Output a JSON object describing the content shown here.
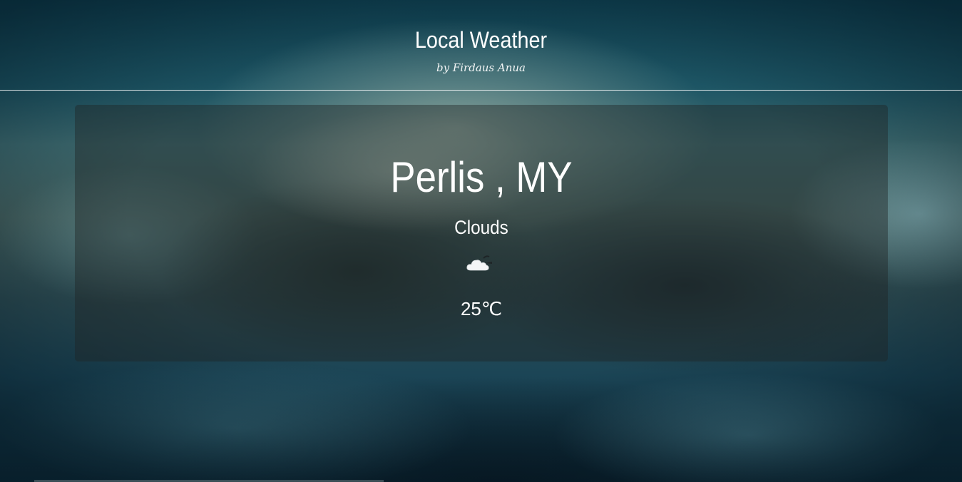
{
  "header": {
    "title": "Local Weather",
    "byline": "by Firdaus Anua"
  },
  "weather": {
    "location": "Perlis , MY",
    "condition": "Clouds",
    "icon": "cloud-icon",
    "temperature": "25℃"
  },
  "colors": {
    "text": "#ffffff",
    "card_background": "rgba(30,35,35,0.42)",
    "divider": "#ffffff"
  }
}
